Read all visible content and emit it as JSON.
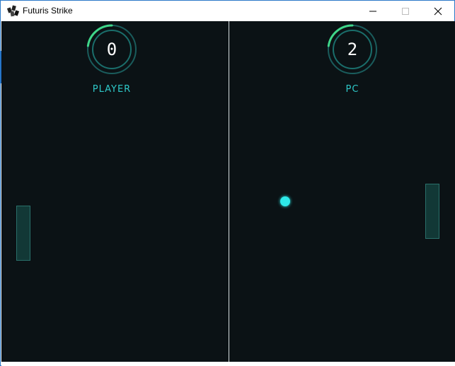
{
  "window": {
    "title": "Futuris Strike",
    "icon": "app-icon",
    "controls": [
      "minimize-icon",
      "maximize-icon",
      "close-icon"
    ]
  },
  "scoreboard": {
    "player": {
      "score": "0",
      "label": "PLAYER"
    },
    "pc": {
      "score": "2",
      "label": "PC"
    }
  },
  "colors": {
    "background": "#0b1215",
    "accent": "#2ec8c8",
    "ball": "#2ee8e8",
    "gauge_arc": "#3fd68a",
    "divider": "#d8e0e2"
  }
}
